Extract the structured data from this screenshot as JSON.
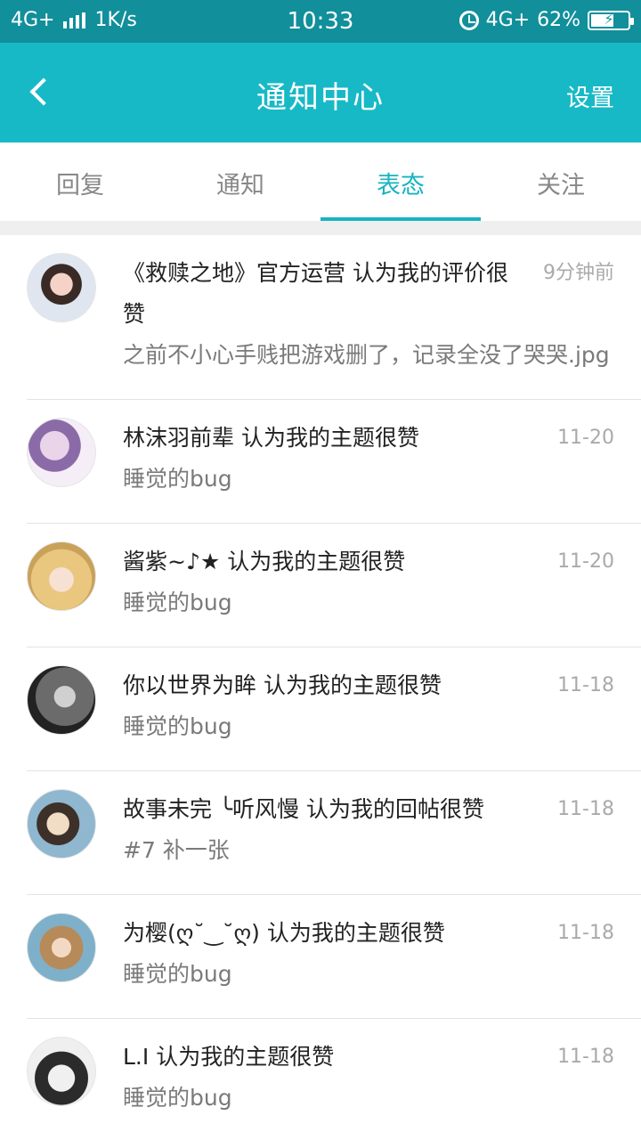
{
  "status_bar": {
    "network_left": "4G+",
    "speed": "1K/s",
    "time": "10:33",
    "network_right": "4G+",
    "battery": "62%",
    "battery_level": 0.62
  },
  "header": {
    "title": "通知中心",
    "settings_label": "设置"
  },
  "tabs": [
    {
      "label": "回复",
      "active": false
    },
    {
      "label": "通知",
      "active": false
    },
    {
      "label": "表态",
      "active": true
    },
    {
      "label": "关注",
      "active": false
    }
  ],
  "notifications": [
    {
      "text": "《救赎之地》官方运营 认为我的评价很赞",
      "subtitle": "之前不小心手贱把游戏删了，记录全没了哭哭.jpg",
      "time": "9分钟前"
    },
    {
      "text": "林沫羽前辈 认为我的主题很赞",
      "subtitle": "睡觉的bug",
      "time": "11-20"
    },
    {
      "text": "酱紫~♪★ 认为我的主题很赞",
      "subtitle": "睡觉的bug",
      "time": "11-20"
    },
    {
      "text": "你以世界为眸 认为我的主题很赞",
      "subtitle": "睡觉的bug",
      "time": "11-18"
    },
    {
      "text": "故事未完  ╰听风慢 认为我的回帖很赞",
      "subtitle": "#7 补一张",
      "time": "11-18"
    },
    {
      "text": "为樱(ღ˘‿˘ღ) 认为我的主题很赞",
      "subtitle": "睡觉的bug",
      "time": "11-18"
    },
    {
      "text": "L.I 认为我的主题很赞",
      "subtitle": "睡觉的bug",
      "time": "11-18"
    }
  ],
  "colors": {
    "status_bar": "#118f9b",
    "app_bar": "#18b9c6",
    "accent": "#18b3c0"
  }
}
